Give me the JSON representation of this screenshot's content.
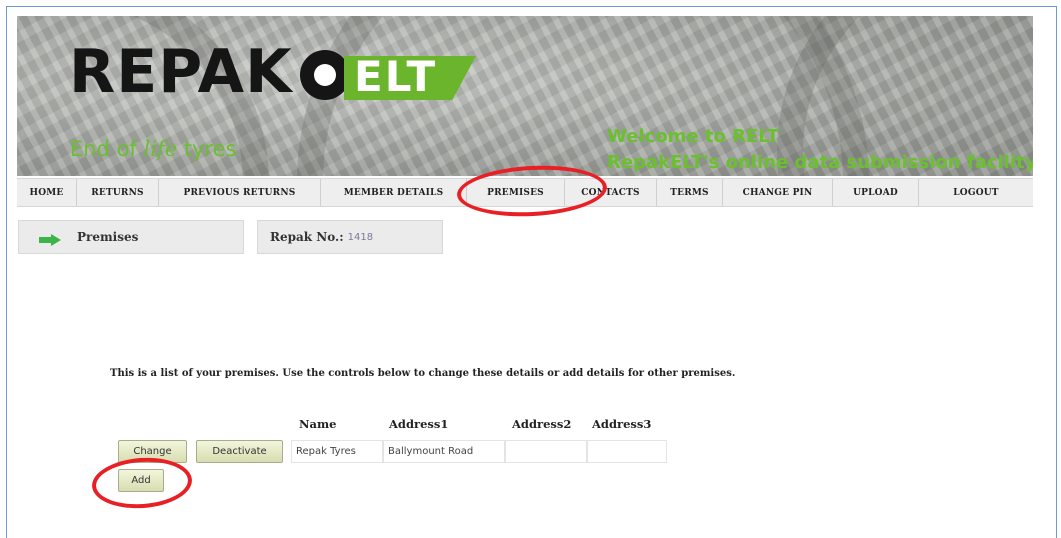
{
  "banner": {
    "logo_word": "REPAK",
    "logo_elt": "ELT",
    "tagline_start": "End of ",
    "tagline_life": "life",
    "tagline_end": " tyres",
    "welcome_line1": "Welcome to RELT",
    "welcome_line2": "RepakELT's online data submission facility"
  },
  "nav": {
    "items": [
      {
        "label": "HOME"
      },
      {
        "label": "RETURNS"
      },
      {
        "label": "PREVIOUS RETURNS"
      },
      {
        "label": "MEMBER DETAILS"
      },
      {
        "label": "PREMISES"
      },
      {
        "label": "CONTACTS"
      },
      {
        "label": "TERMS"
      },
      {
        "label": "CHANGE PIN"
      },
      {
        "label": "UPLOAD"
      },
      {
        "label": "LOGOUT"
      }
    ]
  },
  "page": {
    "title": "Premises",
    "repak_label": "Repak No.:",
    "repak_value": "1418",
    "info": "This is a list of your premises. Use the controls below to change these details or add details for other premises."
  },
  "table": {
    "headers": [
      "Name",
      "Address1",
      "Address2",
      "Address3"
    ],
    "rows": [
      {
        "name": "Repak Tyres",
        "address1": "Ballymount Road",
        "address2": "",
        "address3": ""
      }
    ],
    "change_label": "Change",
    "deactivate_label": "Deactivate",
    "add_label": "Add"
  },
  "colors": {
    "brand_green": "#6bb52c",
    "highlight_red": "#e81f24"
  },
  "icons": {
    "page_arrow": "arrow-right-icon"
  }
}
